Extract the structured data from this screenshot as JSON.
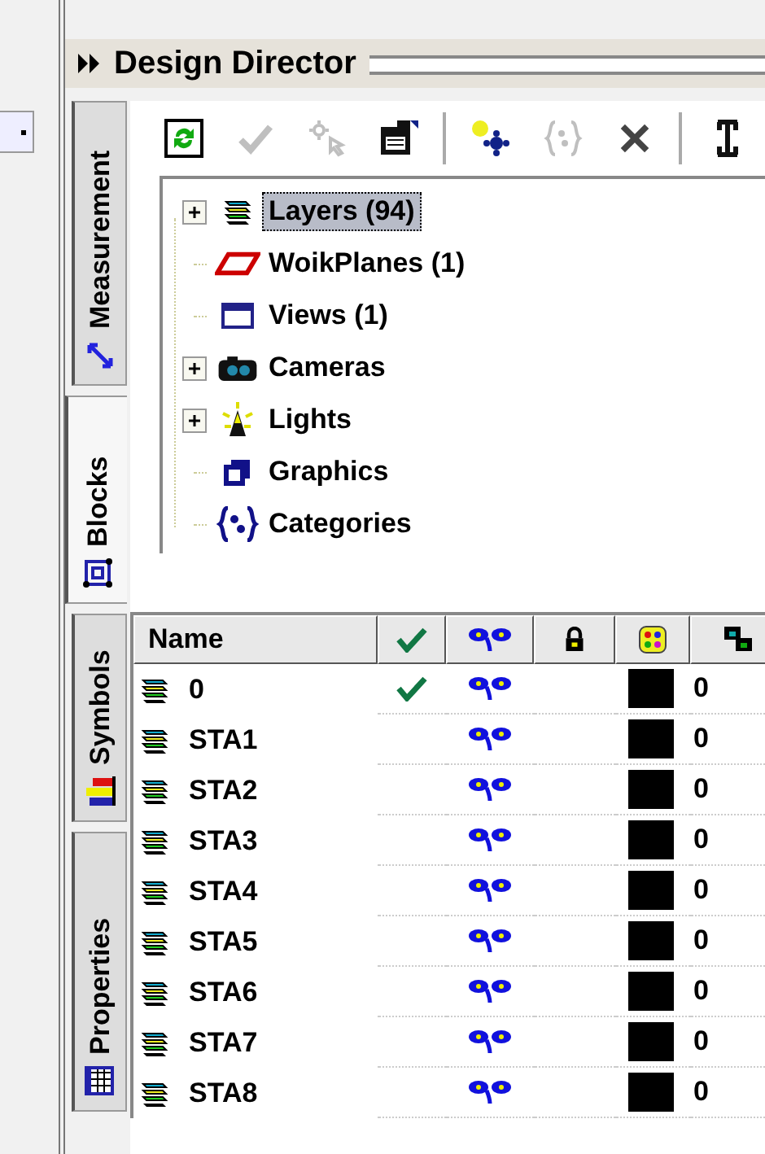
{
  "window": {
    "title": "Design Director"
  },
  "side_tabs": [
    {
      "label": "Measurement",
      "kind": "measure",
      "selected": false
    },
    {
      "label": "Blocks",
      "kind": "blocks",
      "selected": true
    },
    {
      "label": "Symbols",
      "kind": "symbols",
      "selected": false
    },
    {
      "label": "Properties",
      "kind": "properties",
      "selected": false
    }
  ],
  "toolbar": [
    {
      "kind": "refresh",
      "disabled": false
    },
    {
      "kind": "check",
      "disabled": true
    },
    {
      "kind": "pick",
      "disabled": true
    },
    {
      "kind": "properties",
      "disabled": false
    },
    {
      "kind": "separator"
    },
    {
      "kind": "new",
      "disabled": false
    },
    {
      "kind": "braces",
      "disabled": true
    },
    {
      "kind": "delete",
      "disabled": false
    },
    {
      "kind": "separator"
    },
    {
      "kind": "tool",
      "disabled": false
    }
  ],
  "tree": [
    {
      "label": "Layers (94)",
      "kind": "layers",
      "expandable": true,
      "selected": true
    },
    {
      "label": "WoikPlanes (1)",
      "kind": "plane",
      "expandable": false,
      "selected": false
    },
    {
      "label": "Views (1)",
      "kind": "view",
      "expandable": false,
      "selected": false
    },
    {
      "label": "Cameras",
      "kind": "camera",
      "expandable": true,
      "selected": false
    },
    {
      "label": "Lights",
      "kind": "light",
      "expandable": true,
      "selected": false
    },
    {
      "label": "Graphics",
      "kind": "graphics",
      "expandable": false,
      "selected": false
    },
    {
      "label": "Categories",
      "kind": "braces",
      "expandable": false,
      "selected": false
    }
  ],
  "table": {
    "columns": [
      {
        "kind": "name",
        "label": "Name"
      },
      {
        "kind": "current"
      },
      {
        "kind": "visible"
      },
      {
        "kind": "lock"
      },
      {
        "kind": "color"
      },
      {
        "kind": "style"
      }
    ],
    "rows": [
      {
        "name": "0",
        "current": true,
        "visible": true,
        "color": "#000000",
        "column_6": "0"
      },
      {
        "name": "STA1",
        "current": false,
        "visible": true,
        "color": "#000000",
        "column_6": "0"
      },
      {
        "name": "STA2",
        "current": false,
        "visible": true,
        "color": "#000000",
        "column_6": "0"
      },
      {
        "name": "STA3",
        "current": false,
        "visible": true,
        "color": "#000000",
        "column_6": "0"
      },
      {
        "name": "STA4",
        "current": false,
        "visible": true,
        "color": "#000000",
        "column_6": "0"
      },
      {
        "name": "STA5",
        "current": false,
        "visible": true,
        "color": "#000000",
        "column_6": "0"
      },
      {
        "name": "STA6",
        "current": false,
        "visible": true,
        "color": "#000000",
        "column_6": "0"
      },
      {
        "name": "STA7",
        "current": false,
        "visible": true,
        "color": "#000000",
        "column_6": "0"
      },
      {
        "name": "STA8",
        "current": false,
        "visible": true,
        "color": "#000000",
        "column_6": "0"
      }
    ]
  }
}
